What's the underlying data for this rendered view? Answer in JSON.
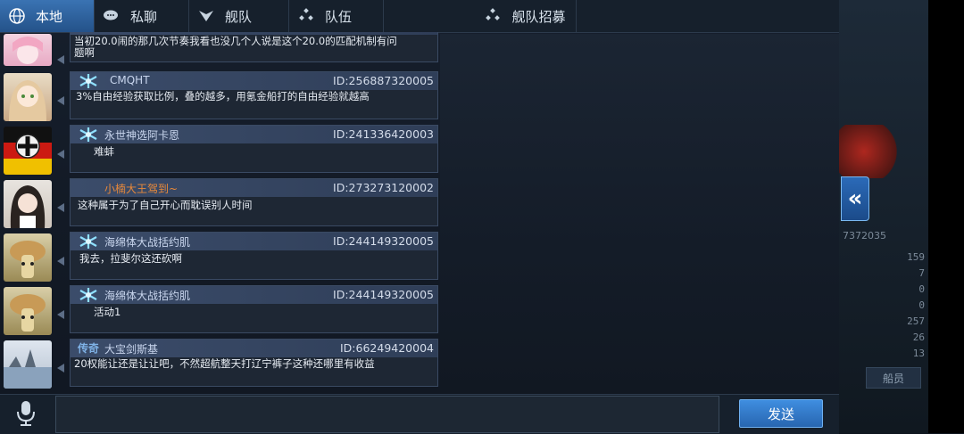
{
  "tabs": [
    {
      "label": "本地",
      "icon": "globe-icon",
      "active": true
    },
    {
      "label": "私聊",
      "icon": "speech-bubbles-icon",
      "active": false
    },
    {
      "label": "舰队",
      "icon": "fleet-icon",
      "active": false
    },
    {
      "label": "队伍",
      "icon": "team-icon",
      "active": false
    },
    {
      "label": "舰队招募",
      "icon": "recruit-icon",
      "active": false
    }
  ],
  "messages": [
    {
      "name": "",
      "id": "",
      "text": "当初20.0闹的那几次节奏我看也没几个人说是这个20.0的匹配机制有问题啊",
      "badge": "none"
    },
    {
      "name": "CMQHT",
      "id": "ID:256887320005",
      "text": "3%自由经验获取比例，叠的越多，用氪金船打的自由经验就越高",
      "badge": "snowflake"
    },
    {
      "name": "永世神选阿卡恩",
      "id": "ID:241336420003",
      "text": "难蚌",
      "badge": "snowflake"
    },
    {
      "name": "小楠大王驾到~",
      "id": "ID:273273120002",
      "text": "这种属于为了自己开心而耽误别人时间",
      "badge": "none"
    },
    {
      "name": "海绵体大战括约肌",
      "id": "ID:244149320005",
      "text": "我去，拉斐尔这还砍啊",
      "badge": "snowflake"
    },
    {
      "name": "海绵体大战括约肌",
      "id": "ID:244149320005",
      "text": "活动1",
      "badge": "snowflake"
    },
    {
      "name": "大宝剑斯基",
      "id": "ID:66249420004",
      "text": "20权能让还是让让吧，不然超航整天打辽宁裤子这种还哪里有收益",
      "badge": "legend",
      "badge_text": "传奇"
    }
  ],
  "send_label": "发送",
  "input": {
    "value": "",
    "placeholder": ""
  },
  "right_panel": {
    "id_fragment": "7372035",
    "button_label": "船员",
    "stats": [
      "159",
      "7",
      "0",
      "0",
      "257",
      "26",
      "13"
    ]
  },
  "colors": {
    "accent": "#2866b0",
    "name_orange": "#e8893a",
    "header": "#3b4c6a"
  }
}
